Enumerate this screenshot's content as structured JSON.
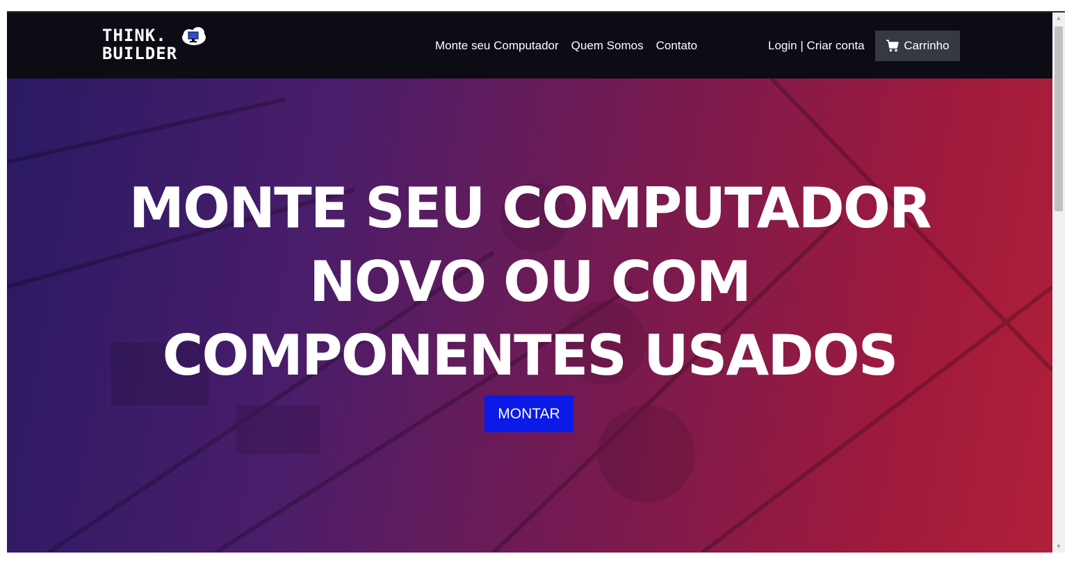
{
  "navbar": {
    "logo_line1": "THINK.",
    "logo_line2": "BUILDER",
    "links": [
      "Monte seu Computador",
      "Quem Somos",
      "Contato"
    ],
    "login_label": "Login",
    "separator": "|",
    "signup_label": "Criar conta",
    "cart_label": "Carrinho"
  },
  "hero": {
    "title_line1": "MONTE SEU COMPUTADOR",
    "title_line2": "NOVO OU COM",
    "title_line3": "COMPONENTES USADOS",
    "cta_label": "MONTAR"
  },
  "colors": {
    "navbar_bg": "#0d0c14",
    "cta_bg": "#0b1ae6",
    "cart_bg": "#343a40",
    "hero_gradient_start": "#2a1a63",
    "hero_gradient_end": "#b0203a"
  },
  "icons": {
    "cart": "cart-icon",
    "logo": "cloud-monitor-icon"
  }
}
